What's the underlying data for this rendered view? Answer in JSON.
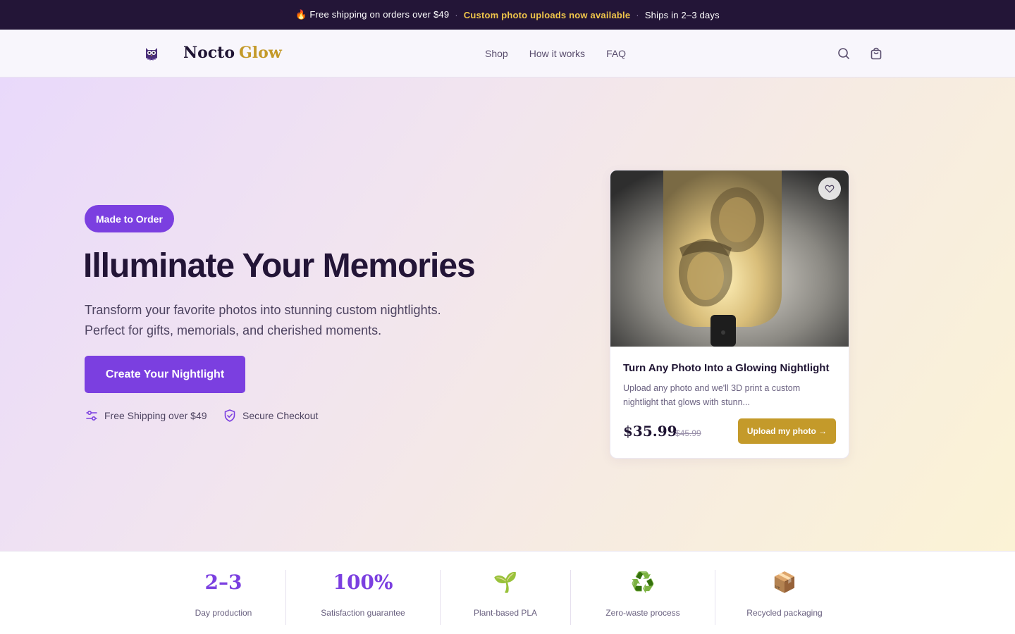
{
  "announcement": {
    "item1": "🔥 Free shipping on orders over $49",
    "sep": "·",
    "item2": "Custom photo uploads now available",
    "item3": "Ships in 2–3 days"
  },
  "header": {
    "brand_main": "Nocto",
    "brand_accent": "Glow",
    "nav": [
      "Shop",
      "How it works",
      "FAQ"
    ],
    "icons": [
      "search-icon",
      "cart-icon"
    ]
  },
  "hero": {
    "badge": "Made to Order",
    "headline": "Illuminate Your Memories",
    "subline1": "Transform your favorite photos into stunning custom nightlights.",
    "subline2": "Perfect for gifts, memorials, and cherished moments.",
    "cta": "Create Your Nightlight",
    "trust": [
      "Free Shipping over $49",
      "Secure Checkout"
    ]
  },
  "product": {
    "title": "Turn Any Photo Into a Glowing Nightlight",
    "description": "Upload any photo and we'll 3D print a custom nightlight that glows with stunn...",
    "price": "$35.99",
    "old_price": "$45.99",
    "button": "Upload my photo →"
  },
  "stats": [
    {
      "value": "2–3",
      "label": "Day production"
    },
    {
      "value": "100%",
      "label": "Satisfaction guarantee"
    },
    {
      "icon": "🌱",
      "label": "Plant-based PLA"
    },
    {
      "icon": "♻️",
      "label": "Zero-waste process"
    },
    {
      "icon": "📦",
      "label": "Recycled packaging"
    }
  ],
  "colors": {
    "accent": "#7b3fe0",
    "gold": "#c49a2a",
    "dark": "#231537"
  }
}
